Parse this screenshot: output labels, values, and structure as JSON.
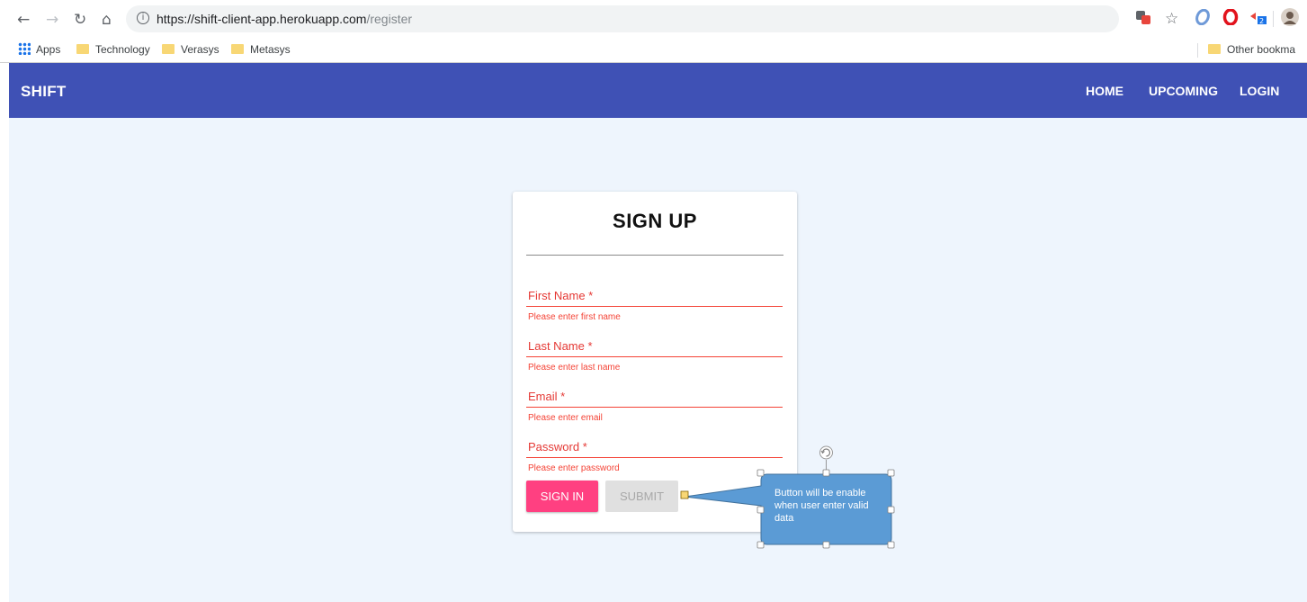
{
  "browser": {
    "url_host": "https://shift-client-app.herokuapp.com",
    "url_path": "/register",
    "bookmarks": [
      "Apps",
      "Technology",
      "Verasys",
      "Metasys"
    ],
    "other_bookmarks": "Other bookma",
    "extension_badge": "2"
  },
  "navbar": {
    "brand": "SHIFT",
    "links": [
      "HOME",
      "UPCOMING",
      "LOGIN"
    ],
    "color": "#3f51b5"
  },
  "form": {
    "title": "SIGN UP",
    "fields": [
      {
        "label": "First Name *",
        "error": "Please enter first name"
      },
      {
        "label": "Last Name *",
        "error": "Please enter last name"
      },
      {
        "label": "Email *",
        "error": "Please enter email"
      },
      {
        "label": "Password *",
        "error": "Please enter password"
      }
    ],
    "signin_label": "SIGN IN",
    "submit_label": "SUBMIT",
    "accent_color": "#ff4081",
    "error_color": "#f44336"
  },
  "annotation": {
    "text": "Button will be enable when user enter valid data",
    "color": "#5b9bd5"
  }
}
